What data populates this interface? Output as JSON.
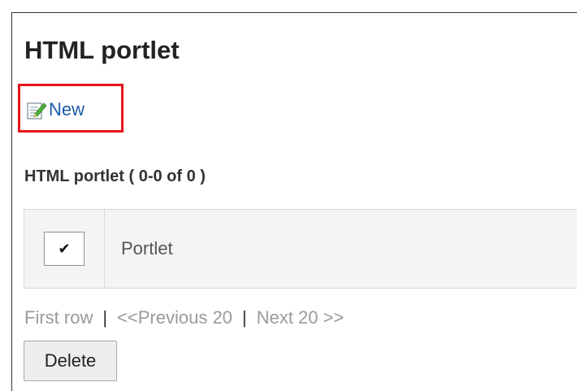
{
  "page": {
    "title": "HTML portlet"
  },
  "toolbar": {
    "new_label": "New",
    "new_icon": "edit-document-icon",
    "highlight_color": "#e8141b"
  },
  "list": {
    "heading": "HTML portlet ( 0-0 of 0 )",
    "select_all_mark": "✔",
    "columns": [
      "Portlet"
    ],
    "rows": []
  },
  "pager": {
    "first": "First row",
    "previous": "<<Previous 20",
    "next": "Next 20 >>",
    "separator": "|"
  },
  "actions": {
    "delete_label": "Delete"
  }
}
